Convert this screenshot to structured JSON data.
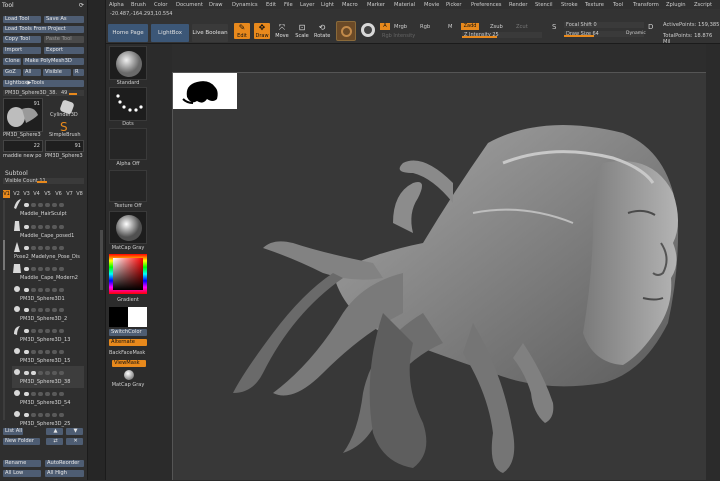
{
  "coords": "-20.487,-164.293,10.554",
  "menu": [
    "Alpha",
    "Brush",
    "Color",
    "Document",
    "Draw",
    "Dynamics",
    "Edit",
    "File",
    "Layer",
    "Light",
    "Macro",
    "Marker",
    "Material",
    "Movie",
    "Picker",
    "Preferences",
    "Render",
    "Stencil",
    "Stroke",
    "Texture",
    "Tool",
    "Transform",
    "Zplugin",
    "Zscript"
  ],
  "tool_panel": {
    "title": "Tool",
    "load_tool": "Load Tool",
    "save_as": "Save As",
    "load_from_project": "Load Tools From Project",
    "copy_tool": "Copy Tool",
    "paste_tool": "Paste Tool",
    "import": "Import",
    "export": "Export",
    "clone": "Clone",
    "make_polymesh": "Make PolyMesh3D",
    "goz": "GoZ",
    "all": "All",
    "visible": "Visible",
    "r": "R",
    "lightbox_tools": "Lightbox▶Tools",
    "current_tool": "PM3D_Sphere3D_38.",
    "current_count": "49",
    "thumb_count_1": "91",
    "thumb_count_2": "22",
    "thumb_count_3": "91",
    "thumb_labels": [
      "PM3D_Sphere3",
      "Cylinder3D",
      "SimpleBrush",
      "maddie new po",
      "PM3D_Sphere3"
    ]
  },
  "subtool": {
    "title": "Subtool",
    "visible_count_label": "Visible Count 11",
    "versions": [
      "V1",
      "V2",
      "V3",
      "V4",
      "V5",
      "V6",
      "V7",
      "V8"
    ],
    "items": [
      "Maddie_HairSculpt",
      "Maddie_Cape_posed1",
      "Pose2_Madelyne_Pose_Dis",
      "Maddie_Cape_Modern2",
      "PM3D_Sphere3D1",
      "PM3D_Sphere3D_2",
      "PM3D_Sphere3D_13",
      "PM3D_Sphere3D_15",
      "PM3D_Sphere3D_38",
      "PM3D_Sphere3D_54",
      "PM3D_Sphere3D_25"
    ],
    "list_all": "List All",
    "new_folder": "New Folder",
    "rename": "Rename",
    "auto_reorder": "AutoReorder",
    "all_low": "All Low",
    "all_high": "All High"
  },
  "palette": {
    "standard": "Standard",
    "dots": "Dots",
    "alpha_off": "Alpha Off",
    "texture_off": "Texture Off",
    "matcap_gray": "MatCap Gray",
    "gradient": "Gradient",
    "switch_color": "SwitchColor",
    "alternate": "Alternate",
    "backface_mask": "BackFaceMask",
    "view_mask": "ViewMask",
    "matcap_gray_2": "MatCap Gray"
  },
  "toolbar": {
    "home_page": "Home Page",
    "lightbox": "LightBox",
    "live_boolean": "Live Boolean",
    "edit": "Edit",
    "draw": "Draw",
    "move": "Move",
    "scale": "Scale",
    "rotate": "Rotate",
    "a": "A",
    "mrgb": "Mrgb",
    "rgb": "Rgb",
    "m": "M",
    "zadd": "Zadd",
    "zsub": "Zsub",
    "zcut": "Zcut",
    "rgb_intensity": "Rgb Intensity",
    "z_intensity": "Z Intensity 25",
    "focal_shift": "Focal Shift 0",
    "draw_size": "Draw Size 64",
    "dynamic": "Dynamic",
    "active_points": "ActivePoints: 159,385",
    "total_points": "TotalPoints: 18.876 Mil"
  },
  "colors": {
    "accent": "#e8891c",
    "button": "#4e5d73",
    "panel": "#2f2f2f",
    "viewport": "#383838"
  }
}
